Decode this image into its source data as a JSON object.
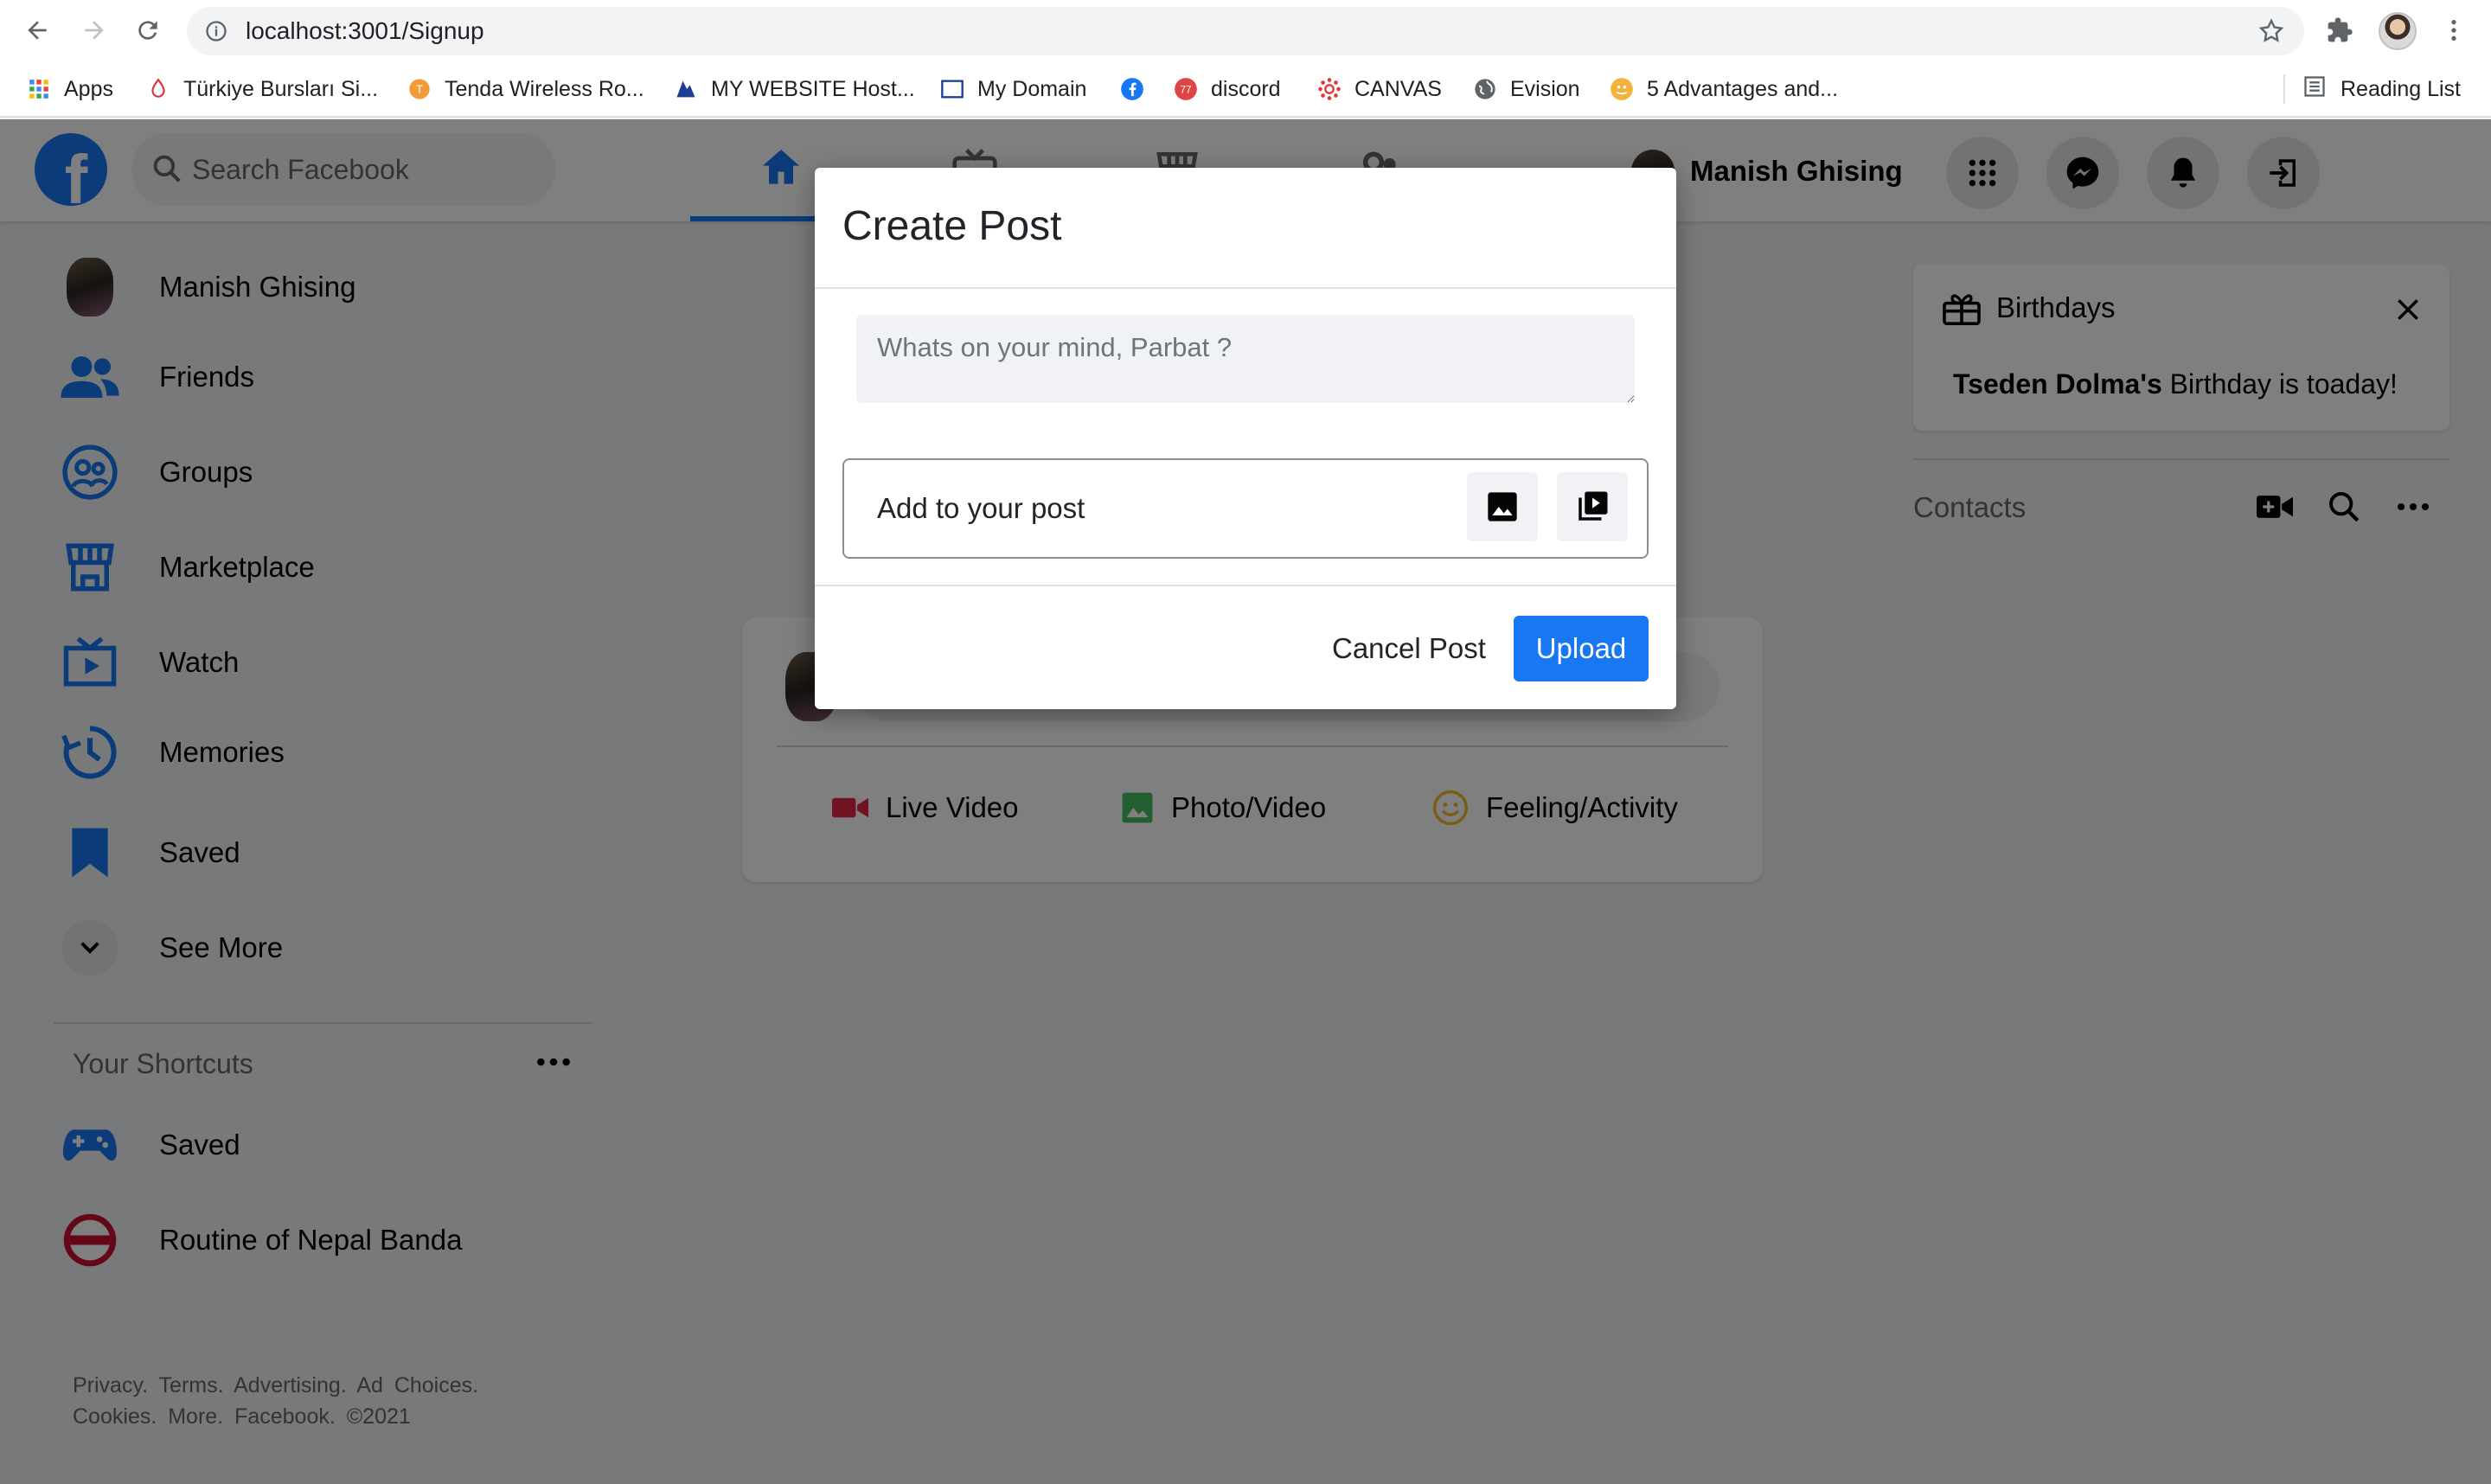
{
  "browser": {
    "url": "localhost:3001/Signup",
    "bookmarks": [
      {
        "label": "Apps",
        "icon": "apps-grid-icon"
      },
      {
        "label": "Türkiye Bursları Si...",
        "icon": "turkiye-burslari-icon"
      },
      {
        "label": "Tenda Wireless Ro...",
        "icon": "tenda-icon"
      },
      {
        "label": "MY WEBSITE Host...",
        "icon": "hosting-icon"
      },
      {
        "label": "My Domain",
        "icon": "domain-icon"
      },
      {
        "label": "",
        "icon": "facebook-icon"
      },
      {
        "label": "discord",
        "icon": "discord-icon"
      },
      {
        "label": "CANVAS",
        "icon": "canvas-icon"
      },
      {
        "label": "Evision",
        "icon": "globe-icon"
      },
      {
        "label": "5 Advantages and...",
        "icon": "article-icon"
      }
    ],
    "reading_list": "Reading List"
  },
  "header": {
    "search_placeholder": "Search Facebook",
    "user_name": "Manish Ghising",
    "tabs": [
      "home-icon",
      "watch-icon",
      "marketplace-icon",
      "groups-icon"
    ],
    "active_tab": "home-icon"
  },
  "sidebar": {
    "items": [
      {
        "label": "Manish Ghising",
        "icon": "avatar"
      },
      {
        "label": "Friends",
        "icon": "friends-icon"
      },
      {
        "label": "Groups",
        "icon": "groups-icon"
      },
      {
        "label": "Marketplace",
        "icon": "marketplace-icon"
      },
      {
        "label": "Watch",
        "icon": "watch-icon"
      },
      {
        "label": "Memories",
        "icon": "memories-icon"
      },
      {
        "label": "Saved",
        "icon": "bookmark-icon"
      },
      {
        "label": "See More",
        "icon": "chevron-down-icon"
      }
    ],
    "shortcuts_title": "Your Shortcuts",
    "shortcuts": [
      {
        "label": "Saved",
        "icon": "gamepad-icon"
      },
      {
        "label": "Routine of Nepal Banda",
        "icon": "ronb-logo"
      }
    ],
    "footer_line1": "Privacy.  Terms.  Advertising.  Ad  Choices.",
    "footer_line2": "Cookies.  More.  Facebook.  ©2021"
  },
  "post_card": {
    "actions": [
      {
        "label": "Live Video",
        "icon": "video-camera-icon",
        "color": "#e42645"
      },
      {
        "label": "Photo/Video",
        "icon": "photo-icon",
        "color": "#45bd62"
      },
      {
        "label": "Feeling/Activity",
        "icon": "smiley-icon",
        "color": "#f7b928"
      }
    ]
  },
  "right": {
    "birthdays_title": "Birthdays",
    "birthday_name": "Tseden Dolma's",
    "birthday_text": " Birthday is toaday!",
    "contacts_title": "Contacts"
  },
  "modal": {
    "title": "Create Post",
    "textarea_placeholder": "Whats on your mind, Parbat ?",
    "add_to_post": "Add to your post",
    "cancel_label": "Cancel Post",
    "upload_label": "Upload"
  },
  "colors": {
    "brand": "#1877f2",
    "overlay": "rgba(0,0,0,0.5)"
  }
}
